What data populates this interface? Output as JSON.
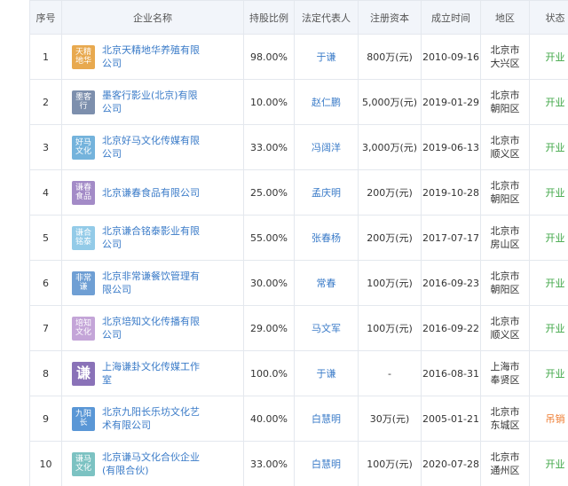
{
  "headers": [
    "序号",
    "企业名称",
    "持股比例",
    "法定代表人",
    "注册资本",
    "成立时间",
    "地区",
    "状态"
  ],
  "rows": [
    {
      "no": "1",
      "logo_text": "天精地华",
      "logo_color": "#e8a94f",
      "name": "北京天精地华养殖有限公司",
      "ratio": "98.00%",
      "legal_rep": "于谦",
      "capital": "800万(元)",
      "date": "2010-09-16",
      "region_line1": "北京市",
      "region_line2": "大兴区",
      "status": "开业",
      "status_type": "open"
    },
    {
      "no": "2",
      "logo_text": "墨客行",
      "logo_color": "#7d8fad",
      "name": "墨客行影业(北京)有限公司",
      "ratio": "10.00%",
      "legal_rep": "赵仁鹏",
      "capital": "5,000万(元)",
      "date": "2019-01-29",
      "region_line1": "北京市",
      "region_line2": "朝阳区",
      "status": "开业",
      "status_type": "open"
    },
    {
      "no": "3",
      "logo_text": "好马文化",
      "logo_color": "#74b3dc",
      "name": "北京好马文化传媒有限公司",
      "ratio": "33.00%",
      "legal_rep": "冯阔洋",
      "capital": "3,000万(元)",
      "date": "2019-06-13",
      "region_line1": "北京市",
      "region_line2": "顺义区",
      "status": "开业",
      "status_type": "open"
    },
    {
      "no": "4",
      "logo_text": "谦春食品",
      "logo_color": "#a38bc7",
      "name": "北京谦春食品有限公司",
      "ratio": "25.00%",
      "legal_rep": "孟庆明",
      "capital": "200万(元)",
      "date": "2019-10-28",
      "region_line1": "北京市",
      "region_line2": "朝阳区",
      "status": "开业",
      "status_type": "open"
    },
    {
      "no": "5",
      "logo_text": "谦合铭泰",
      "logo_color": "#93cbe8",
      "name": "北京谦合铭泰影业有限公司",
      "ratio": "55.00%",
      "legal_rep": "张春杨",
      "capital": "200万(元)",
      "date": "2017-07-17",
      "region_line1": "北京市",
      "region_line2": "房山区",
      "status": "开业",
      "status_type": "open"
    },
    {
      "no": "6",
      "logo_text": "非常谦",
      "logo_color": "#6f9fd4",
      "name": "北京非常谦餐饮管理有限公司",
      "ratio": "30.00%",
      "legal_rep": "常春",
      "capital": "100万(元)",
      "date": "2016-09-23",
      "region_line1": "北京市",
      "region_line2": "朝阳区",
      "status": "开业",
      "status_type": "open"
    },
    {
      "no": "7",
      "logo_text": "培知文化",
      "logo_color": "#c4a5d8",
      "name": "北京培知文化传播有限公司",
      "ratio": "29.00%",
      "legal_rep": "马文军",
      "capital": "100万(元)",
      "date": "2016-09-22",
      "region_line1": "北京市",
      "region_line2": "顺义区",
      "status": "开业",
      "status_type": "open"
    },
    {
      "no": "8",
      "logo_text": "谦",
      "logo_color": "#8a72b8",
      "logo_big": true,
      "name": "上海谦卦文化传媒工作室",
      "ratio": "100.0%",
      "legal_rep": "于谦",
      "capital": "-",
      "date": "2016-08-31",
      "region_line1": "上海市",
      "region_line2": "奉贤区",
      "status": "开业",
      "status_type": "open"
    },
    {
      "no": "9",
      "logo_text": "九阳长",
      "logo_color": "#5a97d6",
      "name": "北京九阳长乐坊文化艺术有限公司",
      "ratio": "40.00%",
      "legal_rep": "白慧明",
      "capital": "30万(元)",
      "date": "2005-01-21",
      "region_line1": "北京市",
      "region_line2": "东城区",
      "status": "吊销",
      "status_type": "revoked"
    },
    {
      "no": "10",
      "logo_text": "谦马文化",
      "logo_color": "#7cc2c2",
      "name": "北京谦马文化合伙企业(有限合伙)",
      "ratio": "33.00%",
      "legal_rep": "白慧明",
      "capital": "100万(元)",
      "date": "2020-07-28",
      "region_line1": "北京市",
      "region_line2": "通州区",
      "status": "开业",
      "status_type": "open"
    }
  ],
  "colors": {
    "link": "#3a7bc8",
    "status_open": "#3ea645",
    "status_revoked": "#ee7a2e",
    "header_bg": "#f2f5fa",
    "border": "#e4e8ee"
  }
}
